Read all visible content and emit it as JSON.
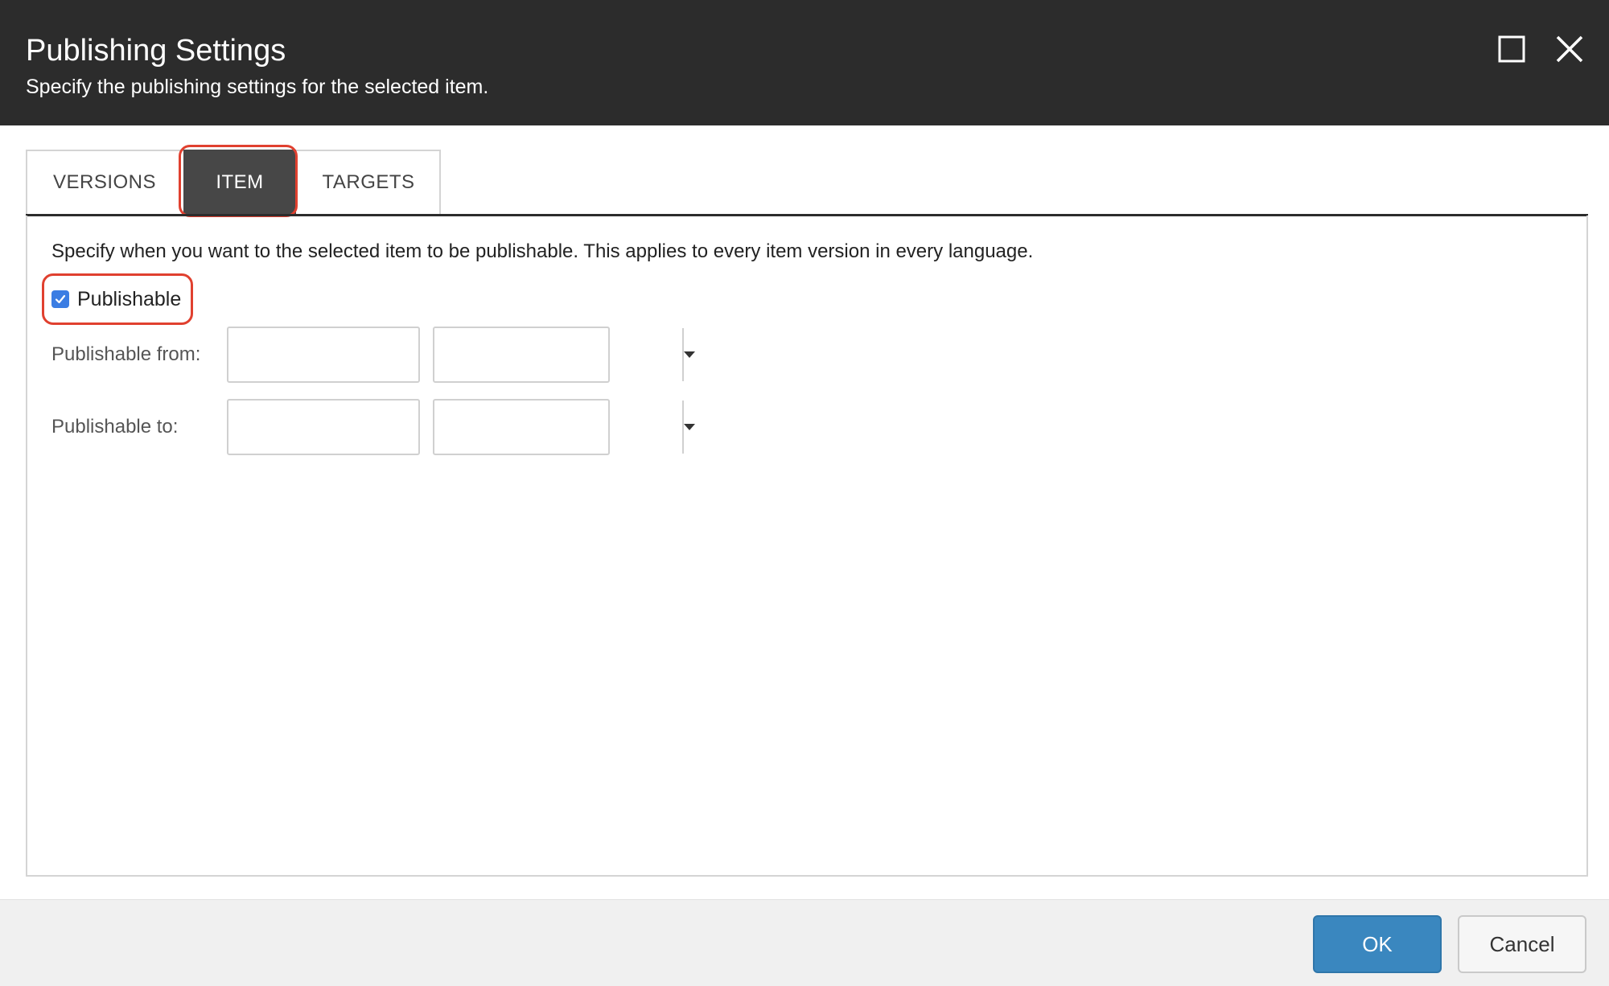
{
  "header": {
    "title": "Publishing Settings",
    "subtitle": "Specify the publishing settings for the selected item."
  },
  "window_controls": {
    "maximize_icon": "maximize-icon",
    "close_icon": "close-icon"
  },
  "tabs": [
    {
      "label": "VERSIONS",
      "active": false
    },
    {
      "label": "ITEM",
      "active": true
    },
    {
      "label": "TARGETS",
      "active": false
    }
  ],
  "item_panel": {
    "description": "Specify when you want to the selected item to be publishable. This applies to every item version in every language.",
    "publishable_checkbox": {
      "label": "Publishable",
      "checked": true
    },
    "publishable_from": {
      "label": "Publishable from:",
      "date": "",
      "time": ""
    },
    "publishable_to": {
      "label": "Publishable to:",
      "date": "",
      "time": ""
    }
  },
  "footer": {
    "ok_label": "OK",
    "cancel_label": "Cancel"
  },
  "colors": {
    "header_bg": "#2c2c2c",
    "active_tab_bg": "#474747",
    "highlight": "#e0402f",
    "checkbox": "#3b7de3",
    "ok_button": "#3a87bf"
  }
}
